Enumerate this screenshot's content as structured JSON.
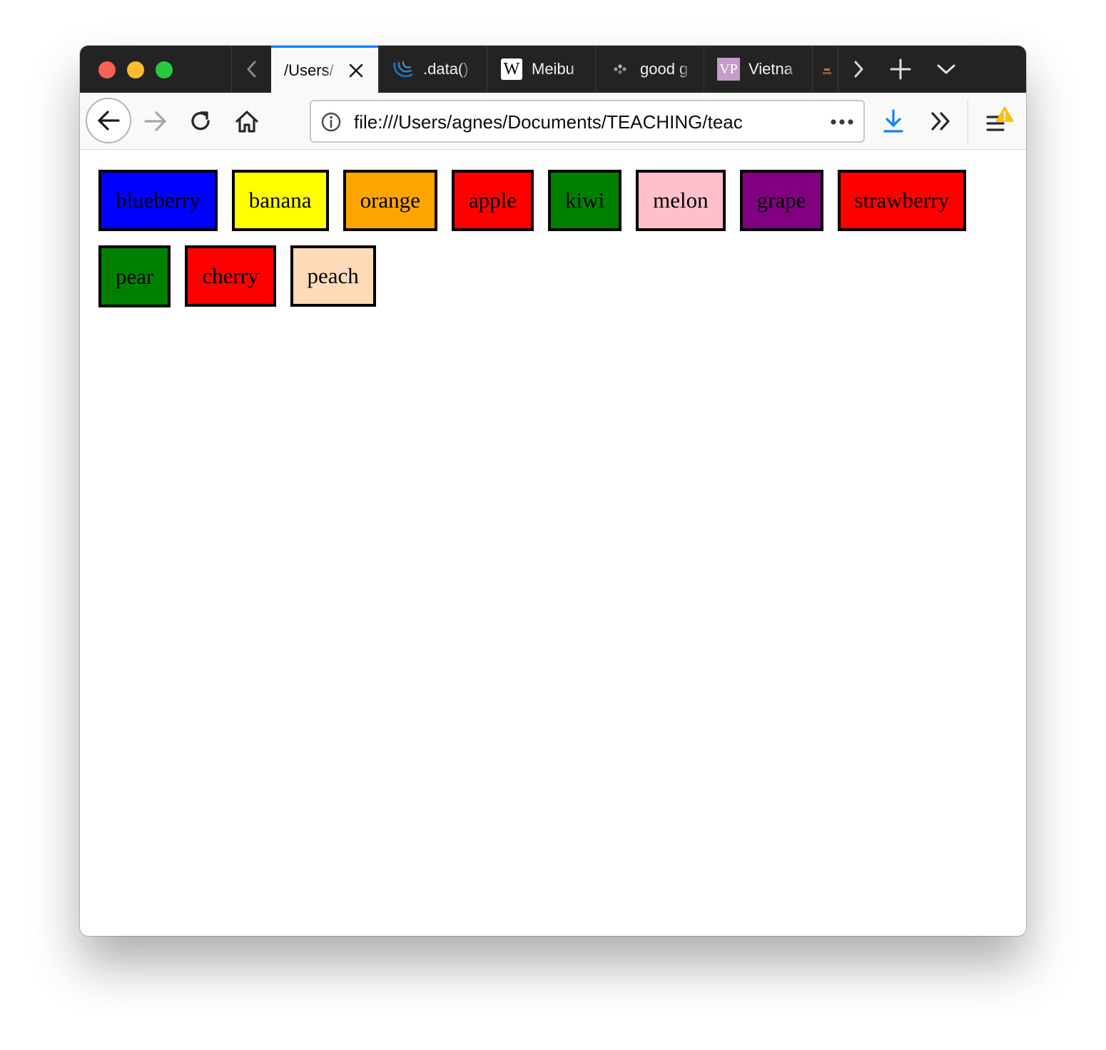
{
  "browser": {
    "tabs": [
      {
        "title": "/Users/",
        "active": true,
        "favicon": "none"
      },
      {
        "title": ".data()",
        "active": false,
        "favicon": "jquery-icon"
      },
      {
        "title": "Meibu",
        "active": false,
        "favicon": "wikipedia-icon",
        "favicon_text": "W"
      },
      {
        "title": "good g",
        "active": false,
        "favicon": "spinner-icon"
      },
      {
        "title": "Vietna",
        "active": false,
        "favicon": "vp-icon",
        "favicon_text": "VP"
      }
    ],
    "address_bar": {
      "url": "file:///Users/agnes/Documents/TEACHING/teac"
    },
    "icons": {
      "back": "back-arrow-icon",
      "forward": "forward-arrow-icon",
      "reload": "reload-icon",
      "home": "home-icon",
      "info": "info-icon",
      "page_actions": "more-dots-icon",
      "downloads": "download-icon",
      "overflow": "chevron-double-right-icon",
      "menu": "hamburger-menu-icon",
      "menu_badge": "warning-icon"
    },
    "accent_color": "#0a84ff"
  },
  "page": {
    "fruits": [
      {
        "label": "blueberry",
        "color": "#0000ff"
      },
      {
        "label": "banana",
        "color": "#ffff00"
      },
      {
        "label": "orange",
        "color": "#ffa500"
      },
      {
        "label": "apple",
        "color": "#ff0000"
      },
      {
        "label": "kiwi",
        "color": "#008000"
      },
      {
        "label": "melon",
        "color": "#ffc0cb"
      },
      {
        "label": "grape",
        "color": "#800080"
      },
      {
        "label": "strawberry",
        "color": "#ff0000"
      },
      {
        "label": "pear",
        "color": "#008000"
      },
      {
        "label": "cherry",
        "color": "#ff0000"
      },
      {
        "label": "peach",
        "color": "#ffdab9"
      }
    ]
  }
}
